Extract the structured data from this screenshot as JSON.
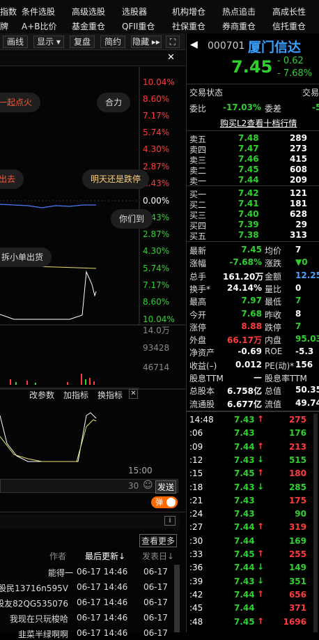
{
  "top_menu": {
    "row1": [
      "指数",
      "条件选股",
      "高级选股",
      "选股器",
      "机构增仓",
      "热点追击",
      "高成长性"
    ],
    "row2": [
      "牌",
      "A+B比价",
      "基金重仓",
      "QFII重仓",
      "社保重仓",
      "券商重仓",
      "信托重仓"
    ]
  },
  "chart_toolbar": {
    "buttons": [
      "画线",
      "显示 ▾",
      "复盘",
      "简约",
      "隐藏 ▸▸",
      "⛶"
    ],
    "close": "✕"
  },
  "pct_ticks": [
    "10.04%",
    "8.60%",
    "7.17%",
    "5.74%",
    "4.30%",
    "2.87%",
    "1.43%",
    "0.00%",
    "1.43%",
    "2.87%",
    "4.30%",
    "5.74%",
    "7.17%",
    "8.60%",
    "10.04%"
  ],
  "volume_ticks": [
    "14.0万",
    "93428",
    "46714"
  ],
  "bubbles": [
    "一起点火",
    "合力",
    "出去",
    "明天还是跌停",
    "你们到",
    "拆小单出货"
  ],
  "indicator_bar": {
    "items": [
      "改参数",
      "加指标",
      "换指标"
    ],
    "close": "✕"
  },
  "time_label": "15:00",
  "comment_bar": {
    "count": "30",
    "emoji": "☺",
    "send": "发送"
  },
  "danmu": {
    "label": "弹",
    "toggle": "on"
  },
  "forum": {
    "view_more": "查看更多",
    "cols": {
      "author": "作者",
      "last_update": "最后更新↓",
      "post_date": "发表日↓"
    },
    "rows": [
      {
        "author": "能得一",
        "update": "06-17 14:46",
        "date": "06-17"
      },
      {
        "author": "股民13716n595V",
        "update": "06-17 14:46",
        "date": "06-17"
      },
      {
        "author": "股友82QG535076",
        "update": "06-17 14:46",
        "date": "06-17"
      },
      {
        "author": "我现在只玩梭哈",
        "update": "06-17 14:46",
        "date": "06-17"
      },
      {
        "author": "韭菜半绿啊啊",
        "update": "06-17 14:46",
        "date": "06-17"
      }
    ]
  },
  "stock": {
    "code": "000701",
    "name": "厦门信达",
    "price": "7.45",
    "change": "- 0.62",
    "change_pct": "- 7.68%"
  },
  "status": {
    "label": "交易状态",
    "label2": "交易"
  },
  "weibi": {
    "label": "委比",
    "value": "-17.03%",
    "label2": "委差",
    "value2": "-5"
  },
  "l2_link": "购买L2查看十档行情",
  "asks": [
    {
      "label": "卖五",
      "price": "7.48",
      "vol": "289"
    },
    {
      "label": "卖四",
      "price": "7.47",
      "vol": "273"
    },
    {
      "label": "卖三",
      "price": "7.46",
      "vol": "415"
    },
    {
      "label": "卖二",
      "price": "7.45",
      "vol": "608"
    },
    {
      "label": "卖一",
      "price": "7.44",
      "vol": "209"
    }
  ],
  "bids": [
    {
      "label": "买一",
      "price": "7.42",
      "vol": "121"
    },
    {
      "label": "买二",
      "price": "7.41",
      "vol": "181"
    },
    {
      "label": "买三",
      "price": "7.40",
      "vol": "628"
    },
    {
      "label": "买四",
      "price": "7.39",
      "vol": "29"
    },
    {
      "label": "买五",
      "price": "7.38",
      "vol": "313"
    }
  ],
  "quote": [
    {
      "l1": "最新",
      "v1": "7.45",
      "c1": "green",
      "l2": "均价",
      "v2": "7",
      "c2": "white"
    },
    {
      "l1": "涨幅",
      "v1": "-7.68%",
      "c1": "green",
      "l2": "涨跌",
      "v2": "▼0",
      "c2": "green"
    },
    {
      "l1": "总手",
      "v1": "161.20万",
      "c1": "white",
      "l2": "金额",
      "v2": "12.25",
      "c2": "blue"
    },
    {
      "l1": "换手*",
      "v1": "24.14%",
      "c1": "white",
      "l2": "量比",
      "v2": "0",
      "c2": "white"
    },
    {
      "l1": "最高",
      "v1": "7.97",
      "c1": "green",
      "l2": "最低",
      "v2": "7",
      "c2": "green"
    },
    {
      "l1": "今开",
      "v1": "7.68",
      "c1": "green",
      "l2": "昨收",
      "v2": "8",
      "c2": "white"
    },
    {
      "l1": "涨停",
      "v1": "8.88",
      "c1": "red",
      "l2": "跌停",
      "v2": "7",
      "c2": "green"
    },
    {
      "l1": "外盘",
      "v1": "66.17万",
      "c1": "red",
      "l2": "内盘",
      "v2": "95.03",
      "c2": "green"
    },
    {
      "l1": "净资产",
      "v1": "-0.69",
      "c1": "white",
      "l2": "ROE",
      "v2": "-5.3",
      "c2": "white"
    },
    {
      "l1": "收益(–)",
      "v1": "0.012",
      "c1": "white",
      "l2": "PE(动)*",
      "v2": "156",
      "c2": "white"
    },
    {
      "l1": "股息TTM",
      "v1": "—",
      "c1": "white",
      "l2": "股息率TTM",
      "v2": "",
      "c2": "white"
    },
    {
      "l1": "总股本",
      "v1": "6.758亿",
      "c1": "white",
      "l2": "总值",
      "v2": "50.35",
      "c2": "white"
    },
    {
      "l1": "流通股",
      "v1": "6.677亿",
      "c1": "white",
      "l2": "流值",
      "v2": "49.74",
      "c2": "white"
    }
  ],
  "trades": [
    {
      "t": "14:48",
      "p": "7.43",
      "a": "↑",
      "v": "275",
      "c": "red"
    },
    {
      "t": ":06",
      "p": "7.43",
      "a": "",
      "v": "176",
      "c": "green"
    },
    {
      "t": ":09",
      "p": "7.44",
      "a": "↑",
      "v": "213",
      "c": "red"
    },
    {
      "t": ":12",
      "p": "7.43",
      "a": "↓",
      "v": "515",
      "c": "green"
    },
    {
      "t": ":15",
      "p": "7.45",
      "a": "↑",
      "v": "180",
      "c": "red"
    },
    {
      "t": ":18",
      "p": "7.43",
      "a": "↓",
      "v": "285",
      "c": "green"
    },
    {
      "t": ":21",
      "p": "7.43",
      "a": "",
      "v": "175",
      "c": "red"
    },
    {
      "t": ":24",
      "p": "7.43",
      "a": "",
      "v": "90",
      "c": "green"
    },
    {
      "t": ":27",
      "p": "7.44",
      "a": "↑",
      "v": "319",
      "c": "red"
    },
    {
      "t": ":30",
      "p": "7.44",
      "a": "",
      "v": "169",
      "c": "green"
    },
    {
      "t": ":33",
      "p": "7.45",
      "a": "↑",
      "v": "255",
      "c": "red"
    },
    {
      "t": ":36",
      "p": "7.44",
      "a": "↓",
      "v": "149",
      "c": "green"
    },
    {
      "t": ":39",
      "p": "7.43",
      "a": "↓",
      "v": "351",
      "c": "green"
    },
    {
      "t": ":42",
      "p": "7.44",
      "a": "↑",
      "v": "656",
      "c": "red"
    },
    {
      "t": ":45",
      "p": "7.44",
      "a": "",
      "v": "371",
      "c": "red"
    },
    {
      "t": ":48",
      "p": "7.45",
      "a": "↑",
      "v": "1696",
      "c": "red"
    }
  ],
  "colors": {
    "up": "#ff3b3b",
    "down": "#2fd12f",
    "accent": "#ff6a00",
    "name": "#3aa0ff"
  }
}
